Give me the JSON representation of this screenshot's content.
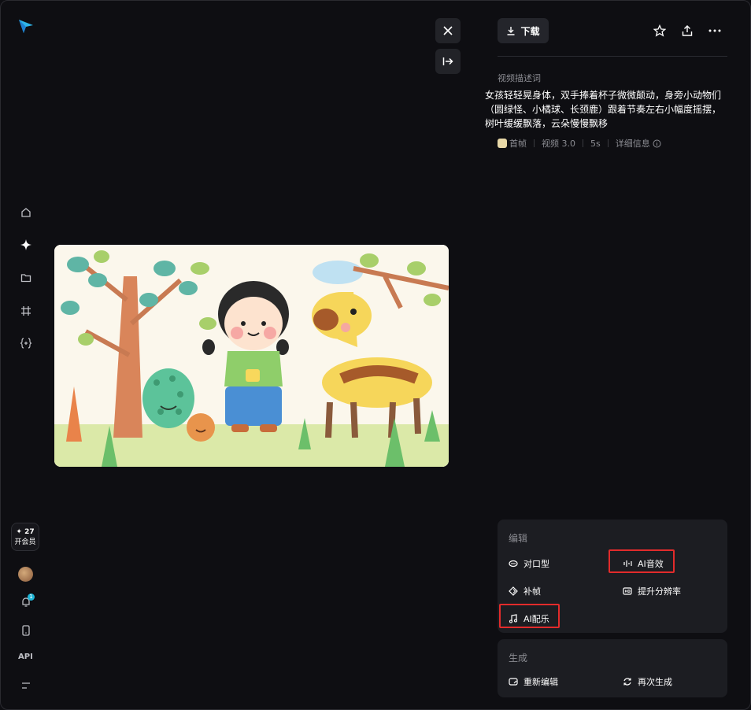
{
  "rail": {
    "member_count": "✦ 27",
    "member_label": "开会员",
    "notification_count": "1",
    "api_label": "API"
  },
  "toolbar": {
    "download_label": "下载"
  },
  "video": {
    "desc_title": "视频描述词",
    "description": "女孩轻轻晃身体，双手捧着杯子微微颠动，身旁小动物们（圆绿怪、小橘球、长颈鹿）跟着节奏左右小幅度摇摆，树叶缓缓飘落，云朵慢慢飘移",
    "meta": {
      "first_frame": "首帧",
      "model": "视频 3.0",
      "duration": "5s",
      "details": "详细信息"
    }
  },
  "edit": {
    "title": "编辑",
    "lip_sync": "对口型",
    "ai_sound": "AI音效",
    "interpolate": "补帧",
    "upscale": "提升分辨率",
    "ai_music": "AI配乐"
  },
  "generate": {
    "title": "生成",
    "re_edit": "重新编辑",
    "regenerate": "再次生成"
  },
  "colors": {
    "background": "#0e0e12",
    "card": "#1c1d22",
    "highlight": "#e22b2b",
    "accent": "#1fb6d8"
  }
}
